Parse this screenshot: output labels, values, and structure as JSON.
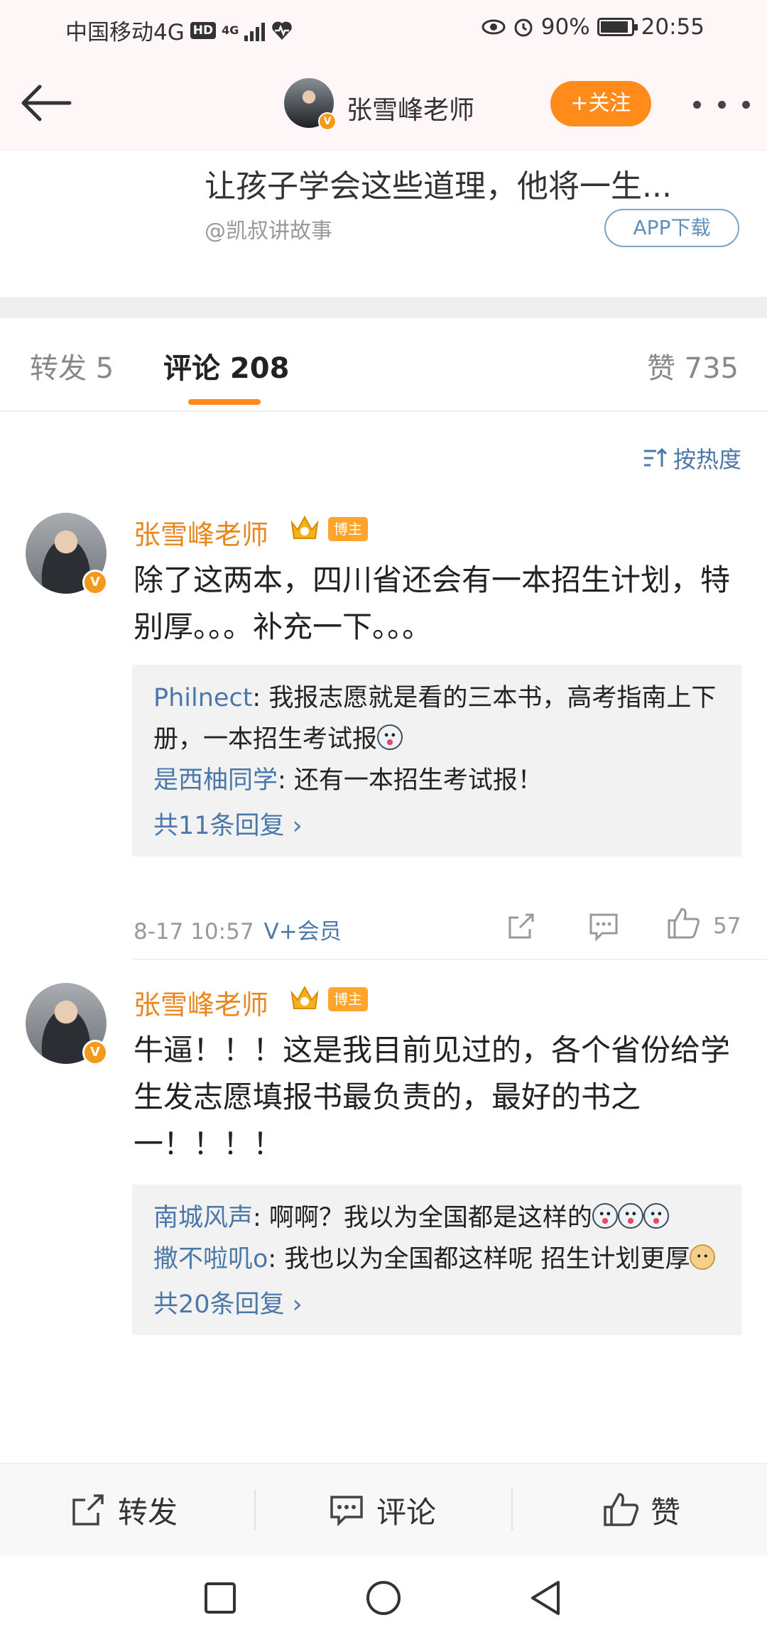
{
  "status_bar": {
    "carrier": "中国移动4G",
    "hd": "HD",
    "net": "4G",
    "battery": "90%",
    "battery_level": 0.9,
    "time": "20:55"
  },
  "header": {
    "name": "张雪峰老师",
    "follow_label": "+关注",
    "verified": "V"
  },
  "repost_card": {
    "title": "让孩子学会这些道理，他将一生...",
    "source": "@凯叔讲故事",
    "app_button": "APP下载"
  },
  "tabs": {
    "repost": "转发 5",
    "comments": "评论 208",
    "likes": "赞 735"
  },
  "sort_label": "按热度",
  "comments": [
    {
      "name": "张雪峰老师",
      "badge": "博主",
      "text": "除了这两本，四川省还会有一本招生计划，特别厚。。。补充一下。。。",
      "replies": [
        {
          "user": "Philnect",
          "text": ": 我报志愿就是看的三本书，高考指南上下册，一本招生考试报"
        },
        {
          "user": "是西柚同学",
          "text": ": 还有一本招生考试报！"
        }
      ],
      "total": "共11条回复 ›",
      "time": "8-17 10:57",
      "vip": "V+会员",
      "likes": "57"
    },
    {
      "name": "张雪峰老师",
      "badge": "博主",
      "text": "牛逼！！！这是我目前见过的，各个省份给学生发志愿填报书最负责的，最好的书之一！！！！",
      "replies": [
        {
          "user": "南城风声",
          "text": ": 啊啊？我以为全国都是这样的"
        },
        {
          "user": "撒不啦叽o",
          "text": ": 我也以为全国都这样呢 招生计划更厚"
        }
      ],
      "total": "共20条回复 ›"
    }
  ],
  "action_bar": {
    "repost": "转发",
    "comment": "评论",
    "like": "赞"
  },
  "colors": {
    "accent": "#ff8c1a",
    "link": "#4b78a9",
    "name": "#e8861f"
  }
}
